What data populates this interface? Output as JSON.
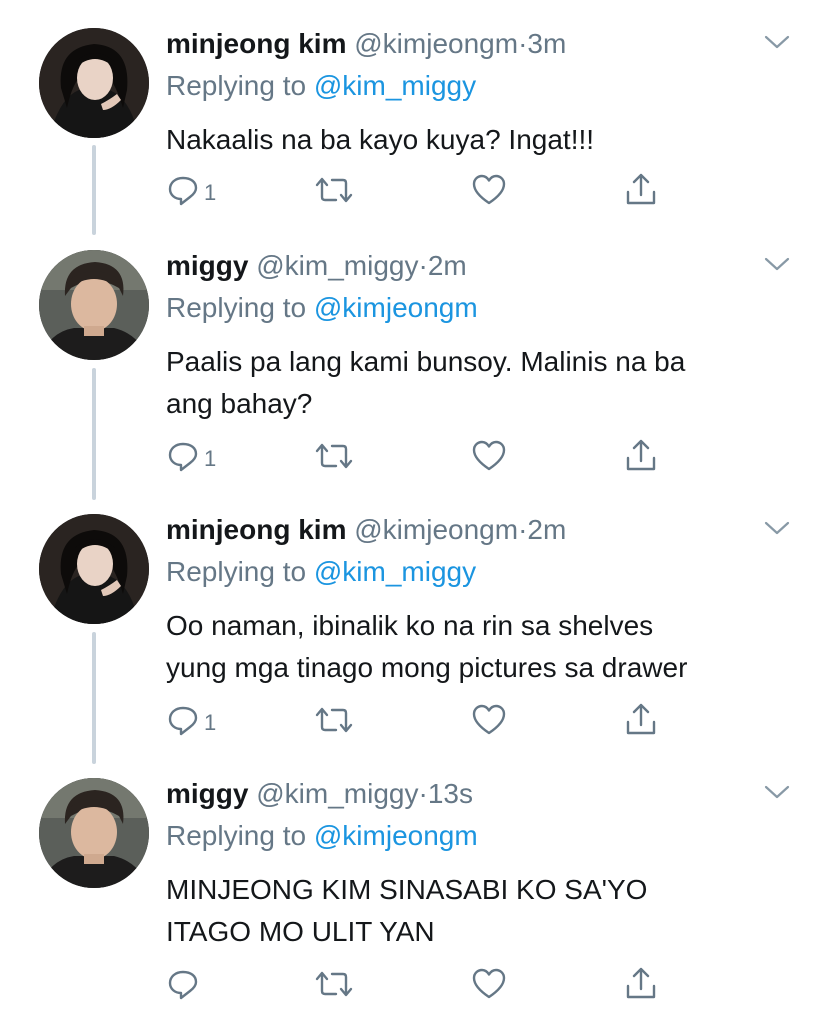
{
  "tweets": [
    {
      "name": "minjeong kim",
      "handle": "@kimjeongm",
      "time": "3m",
      "replying_prefix": "Replying to",
      "replying_to": "@kim_miggy",
      "text_lines": [
        "Nakaalis na ba kayo kuya? Ingat!!!"
      ],
      "reply_count": "1",
      "avatar_icon": "avatar-girl"
    },
    {
      "name": "miggy",
      "handle": "@kim_miggy",
      "time": "2m",
      "replying_prefix": "Replying to",
      "replying_to": "@kimjeongm",
      "text_lines": [
        "Paalis pa lang kami bunsoy. Malinis na ba",
        "ang bahay?"
      ],
      "reply_count": "1",
      "avatar_icon": "avatar-boy"
    },
    {
      "name": "minjeong kim",
      "handle": "@kimjeongm",
      "time": "2m",
      "replying_prefix": "Replying to",
      "replying_to": "@kim_miggy",
      "text_lines": [
        "Oo naman, ibinalik ko na rin sa shelves",
        "yung mga tinago mong pictures sa drawer"
      ],
      "reply_count": "1",
      "avatar_icon": "avatar-girl"
    },
    {
      "name": "miggy",
      "handle": "@kim_miggy",
      "time": "13s",
      "replying_prefix": "Replying to",
      "replying_to": "@kimjeongm",
      "text_lines": [
        "MINJEONG KIM SINASABI KO SA'YO",
        "ITAGO MO ULIT YAN"
      ],
      "reply_count": "",
      "avatar_icon": "avatar-boy"
    }
  ],
  "separator": "·",
  "icons": [
    "reply-icon",
    "retweet-icon",
    "like-icon",
    "share-icon",
    "chevron-down-icon"
  ],
  "colors": {
    "handle": "#657786",
    "mention": "#1b95e0",
    "thread_line": "#c9d3dc"
  }
}
